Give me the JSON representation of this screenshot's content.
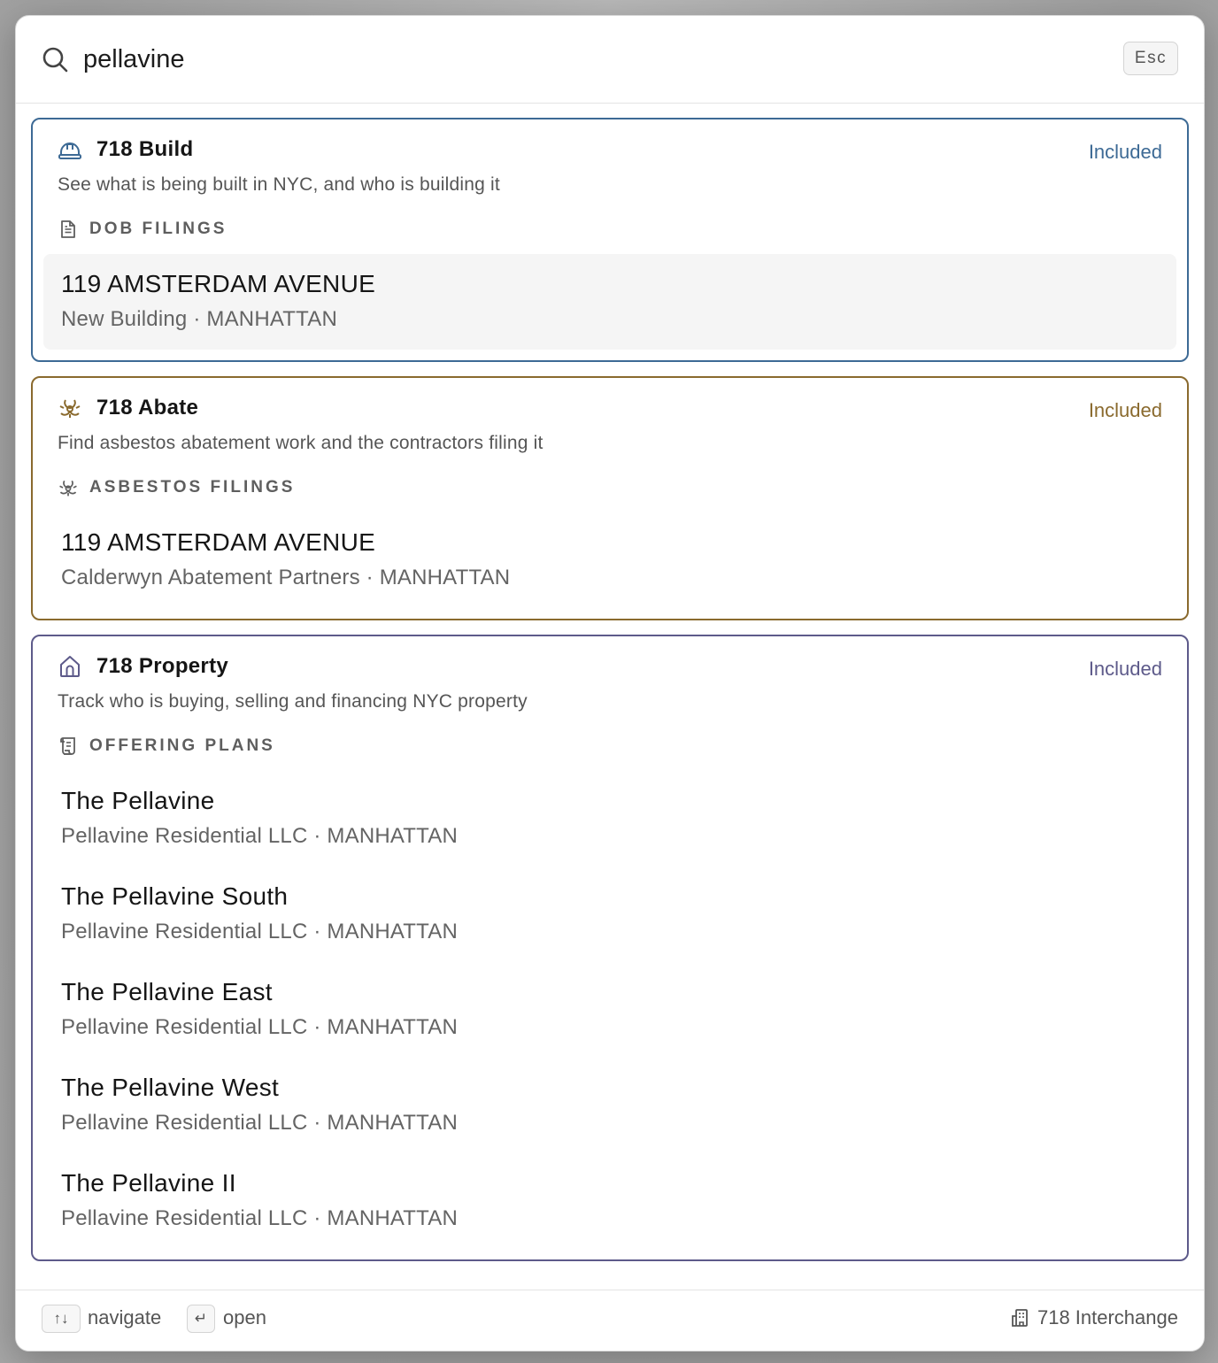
{
  "search": {
    "query": "pellavine",
    "esc_label": "Esc"
  },
  "colors": {
    "build": "#3d6a95",
    "abate": "#8a6a2e",
    "property": "#5d5a8a"
  },
  "cards": [
    {
      "title": "718 Build",
      "icon": "hardhat-icon",
      "badge": "Included",
      "description": "See what is being built in NYC, and who is building it",
      "section": {
        "icon": "document-icon",
        "label": "DOB FILINGS"
      },
      "items": [
        {
          "title": "119 AMSTERDAM AVENUE",
          "subtitle": "New Building · MANHATTAN"
        }
      ]
    },
    {
      "title": "718 Abate",
      "icon": "biohazard-icon",
      "badge": "Included",
      "description": "Find asbestos abatement work and the contractors filing it",
      "section": {
        "icon": "biohazard-icon",
        "label": "ASBESTOS FILINGS"
      },
      "items": [
        {
          "title": "119 AMSTERDAM AVENUE",
          "subtitle": "Calderwyn Abatement Partners · MANHATTAN"
        }
      ]
    },
    {
      "title": "718 Property",
      "icon": "house-icon",
      "badge": "Included",
      "description": "Track who is buying, selling and financing NYC property",
      "section": {
        "icon": "scroll-icon",
        "label": "OFFERING PLANS"
      },
      "items": [
        {
          "title": "The Pellavine",
          "subtitle": "Pellavine Residential LLC · MANHATTAN"
        },
        {
          "title": "The Pellavine South",
          "subtitle": "Pellavine Residential LLC · MANHATTAN"
        },
        {
          "title": "The Pellavine East",
          "subtitle": "Pellavine Residential LLC · MANHATTAN"
        },
        {
          "title": "The Pellavine West",
          "subtitle": "Pellavine Residential LLC · MANHATTAN"
        },
        {
          "title": "The Pellavine II",
          "subtitle": "Pellavine Residential LLC · MANHATTAN"
        }
      ]
    }
  ],
  "footer": {
    "navigate_key": "↑↓",
    "navigate_label": "navigate",
    "open_key": "↵",
    "open_label": "open",
    "brand_label": "718 Interchange"
  }
}
